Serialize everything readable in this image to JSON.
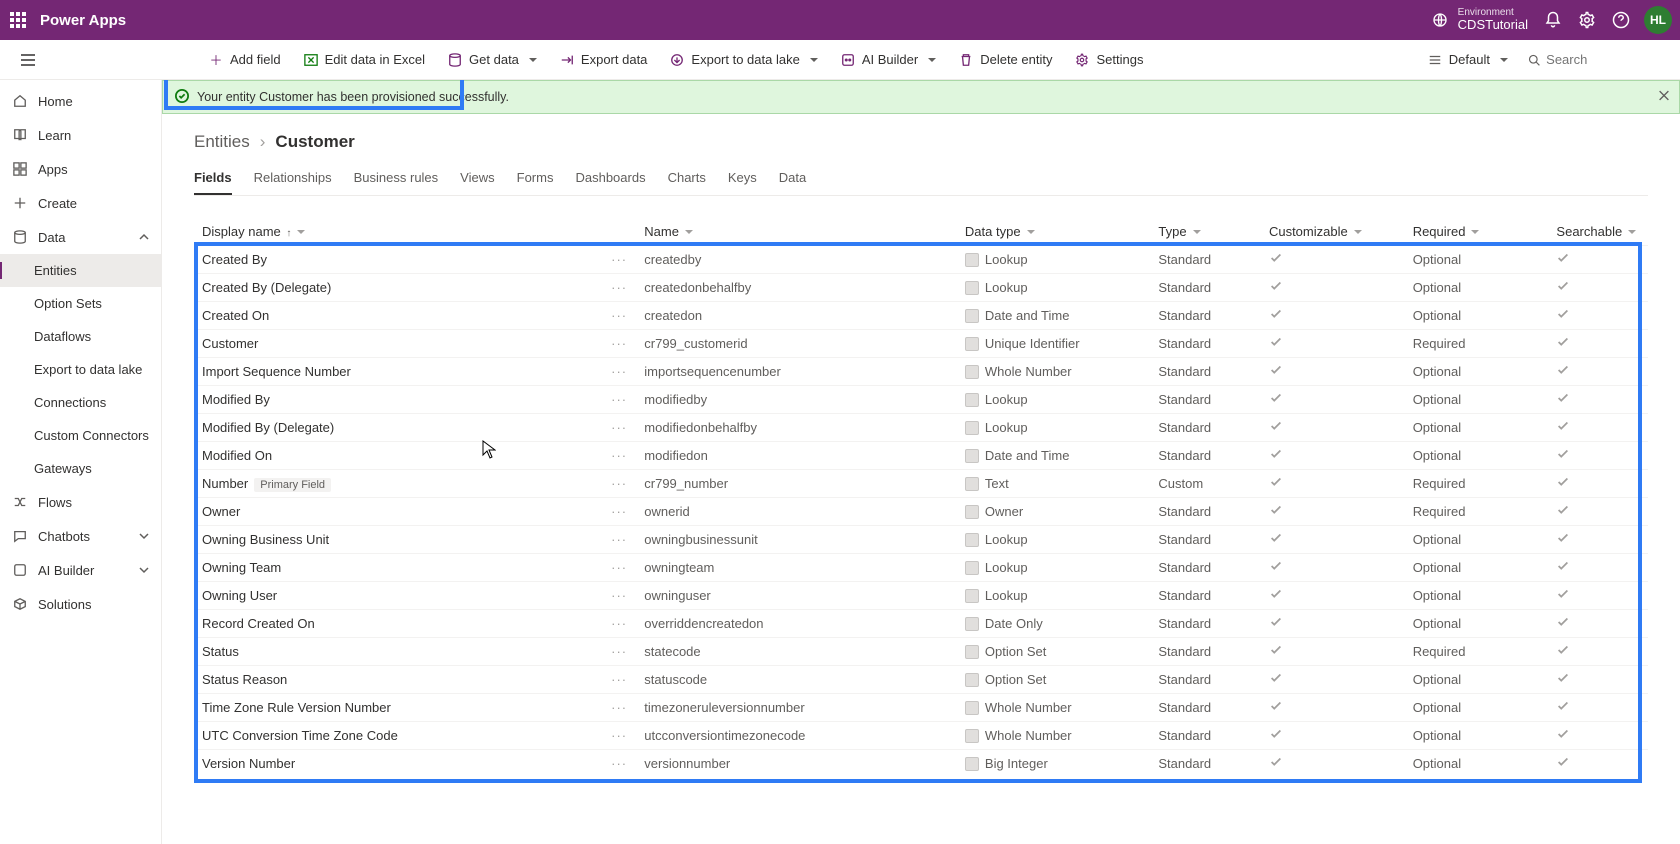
{
  "header": {
    "app_title": "Power Apps",
    "env_label": "Environment",
    "env_name": "CDSTutorial",
    "avatar_initials": "HL"
  },
  "commandbar": {
    "add_field": "Add field",
    "edit_excel": "Edit data in Excel",
    "get_data": "Get data",
    "export_data": "Export data",
    "export_lake": "Export to data lake",
    "ai_builder": "AI Builder",
    "delete_entity": "Delete entity",
    "settings": "Settings",
    "view_mode": "Default",
    "search_placeholder": "Search"
  },
  "sidebar": {
    "items": [
      {
        "label": "Home"
      },
      {
        "label": "Learn"
      },
      {
        "label": "Apps"
      },
      {
        "label": "Create"
      },
      {
        "label": "Data"
      },
      {
        "label": "Entities"
      },
      {
        "label": "Option Sets"
      },
      {
        "label": "Dataflows"
      },
      {
        "label": "Export to data lake"
      },
      {
        "label": "Connections"
      },
      {
        "label": "Custom Connectors"
      },
      {
        "label": "Gateways"
      },
      {
        "label": "Flows"
      },
      {
        "label": "Chatbots"
      },
      {
        "label": "AI Builder"
      },
      {
        "label": "Solutions"
      }
    ]
  },
  "notification": {
    "text": "Your entity Customer has been provisioned successfully."
  },
  "breadcrumb": {
    "root": "Entities",
    "current": "Customer"
  },
  "tabs": [
    "Fields",
    "Relationships",
    "Business rules",
    "Views",
    "Forms",
    "Dashboards",
    "Charts",
    "Keys",
    "Data"
  ],
  "columns": {
    "display_name": "Display name",
    "name": "Name",
    "data_type": "Data type",
    "type": "Type",
    "customizable": "Customizable",
    "required": "Required",
    "searchable": "Searchable"
  },
  "primary_field_tag": "Primary Field",
  "rows": [
    {
      "display": "Created By",
      "name": "createdby",
      "dtype": "Lookup",
      "type": "Standard",
      "cust": true,
      "req": "Optional",
      "srch": true
    },
    {
      "display": "Created By (Delegate)",
      "name": "createdonbehalfby",
      "dtype": "Lookup",
      "type": "Standard",
      "cust": true,
      "req": "Optional",
      "srch": true
    },
    {
      "display": "Created On",
      "name": "createdon",
      "dtype": "Date and Time",
      "type": "Standard",
      "cust": true,
      "req": "Optional",
      "srch": true
    },
    {
      "display": "Customer",
      "name": "cr799_customerid",
      "dtype": "Unique Identifier",
      "type": "Standard",
      "cust": true,
      "req": "Required",
      "srch": true
    },
    {
      "display": "Import Sequence Number",
      "name": "importsequencenumber",
      "dtype": "Whole Number",
      "type": "Standard",
      "cust": true,
      "req": "Optional",
      "srch": true
    },
    {
      "display": "Modified By",
      "name": "modifiedby",
      "dtype": "Lookup",
      "type": "Standard",
      "cust": true,
      "req": "Optional",
      "srch": true
    },
    {
      "display": "Modified By (Delegate)",
      "name": "modifiedonbehalfby",
      "dtype": "Lookup",
      "type": "Standard",
      "cust": true,
      "req": "Optional",
      "srch": true
    },
    {
      "display": "Modified On",
      "name": "modifiedon",
      "dtype": "Date and Time",
      "type": "Standard",
      "cust": true,
      "req": "Optional",
      "srch": true
    },
    {
      "display": "Number",
      "name": "cr799_number",
      "dtype": "Text",
      "type": "Custom",
      "cust": true,
      "req": "Required",
      "srch": true,
      "primary": true
    },
    {
      "display": "Owner",
      "name": "ownerid",
      "dtype": "Owner",
      "type": "Standard",
      "cust": true,
      "req": "Required",
      "srch": true
    },
    {
      "display": "Owning Business Unit",
      "name": "owningbusinessunit",
      "dtype": "Lookup",
      "type": "Standard",
      "cust": true,
      "req": "Optional",
      "srch": true
    },
    {
      "display": "Owning Team",
      "name": "owningteam",
      "dtype": "Lookup",
      "type": "Standard",
      "cust": true,
      "req": "Optional",
      "srch": true
    },
    {
      "display": "Owning User",
      "name": "owninguser",
      "dtype": "Lookup",
      "type": "Standard",
      "cust": true,
      "req": "Optional",
      "srch": true
    },
    {
      "display": "Record Created On",
      "name": "overriddencreatedon",
      "dtype": "Date Only",
      "type": "Standard",
      "cust": true,
      "req": "Optional",
      "srch": true
    },
    {
      "display": "Status",
      "name": "statecode",
      "dtype": "Option Set",
      "type": "Standard",
      "cust": true,
      "req": "Required",
      "srch": true
    },
    {
      "display": "Status Reason",
      "name": "statuscode",
      "dtype": "Option Set",
      "type": "Standard",
      "cust": true,
      "req": "Optional",
      "srch": true
    },
    {
      "display": "Time Zone Rule Version Number",
      "name": "timezoneruleversionnumber",
      "dtype": "Whole Number",
      "type": "Standard",
      "cust": true,
      "req": "Optional",
      "srch": true
    },
    {
      "display": "UTC Conversion Time Zone Code",
      "name": "utcconversiontimezonecode",
      "dtype": "Whole Number",
      "type": "Standard",
      "cust": true,
      "req": "Optional",
      "srch": true
    },
    {
      "display": "Version Number",
      "name": "versionnumber",
      "dtype": "Big Integer",
      "type": "Standard",
      "cust": true,
      "req": "Optional",
      "srch": true
    }
  ]
}
